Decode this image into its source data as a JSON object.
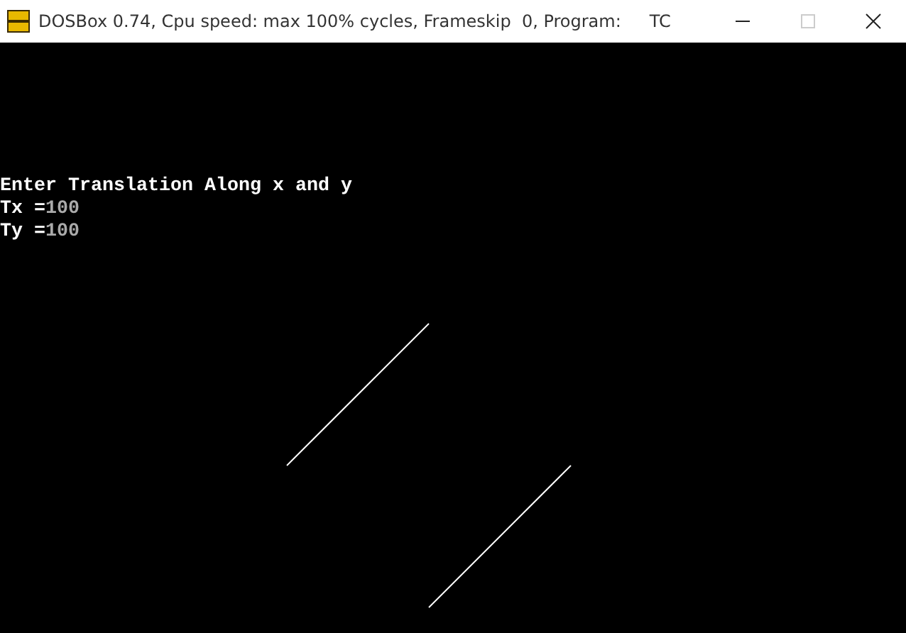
{
  "window": {
    "title": "DOSBox 0.74, Cpu speed: max 100% cycles, Frameskip  0, Program:",
    "program": "TC",
    "controls": [
      {
        "kind": "minimize",
        "disabled": false
      },
      {
        "kind": "maximize",
        "disabled": true
      },
      {
        "kind": "close",
        "disabled": false
      }
    ]
  },
  "console": {
    "lines": [
      {
        "kind": "prompt",
        "text": "Enter Translation Along x and y"
      },
      {
        "kind": "input",
        "label": "Tx =",
        "value": "100"
      },
      {
        "kind": "input",
        "label": "Ty =",
        "value": "100"
      }
    ]
  }
}
